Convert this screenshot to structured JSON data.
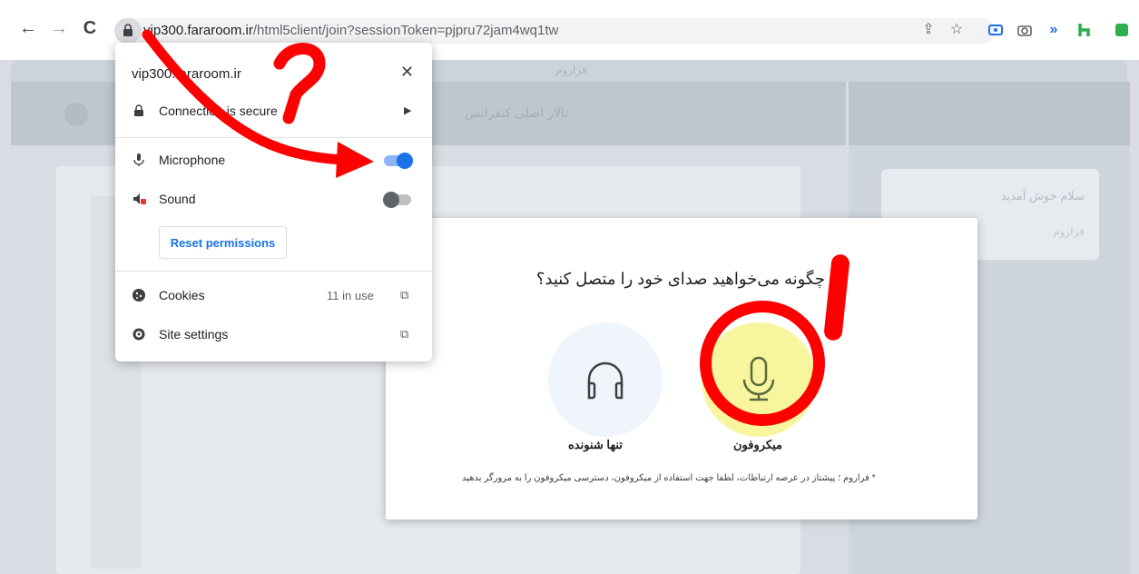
{
  "browser": {
    "url_host": "vip300.fararoom.ir",
    "url_path": "/html5client/join?sessionToken=pjpru72jam4wq1tw"
  },
  "popup": {
    "domain": "vip300.fararoom.ir",
    "connection_label": "Connection is secure",
    "microphone_label": "Microphone",
    "sound_label": "Sound",
    "reset_label": "Reset permissions",
    "cookies_label": "Cookies",
    "cookies_count": "11 in use",
    "site_settings_label": "Site settings",
    "microphone_enabled": true,
    "sound_enabled": false
  },
  "app": {
    "brand": "فراروم",
    "header_title": "تالار اصلی کنفرانس",
    "chat_welcome": "سلام خوش آمدید",
    "chat_sub": "فراروم"
  },
  "modal": {
    "title": "چگونه می‌خواهید صدای خود را متصل کنید؟",
    "listen_label": "تنها شنونده",
    "mic_label": "میکروفون",
    "note": "* فراروم ؛ پیشتاز در عرصه ارتباطات، لطفا جهت استفاده از میکروفون، دسترسی میکروفون را به مرورگر بدهید"
  },
  "colors": {
    "annotation": "#ff0000",
    "mic_highlight": "#f7f59e",
    "toggle_on": "#1a73e8"
  }
}
